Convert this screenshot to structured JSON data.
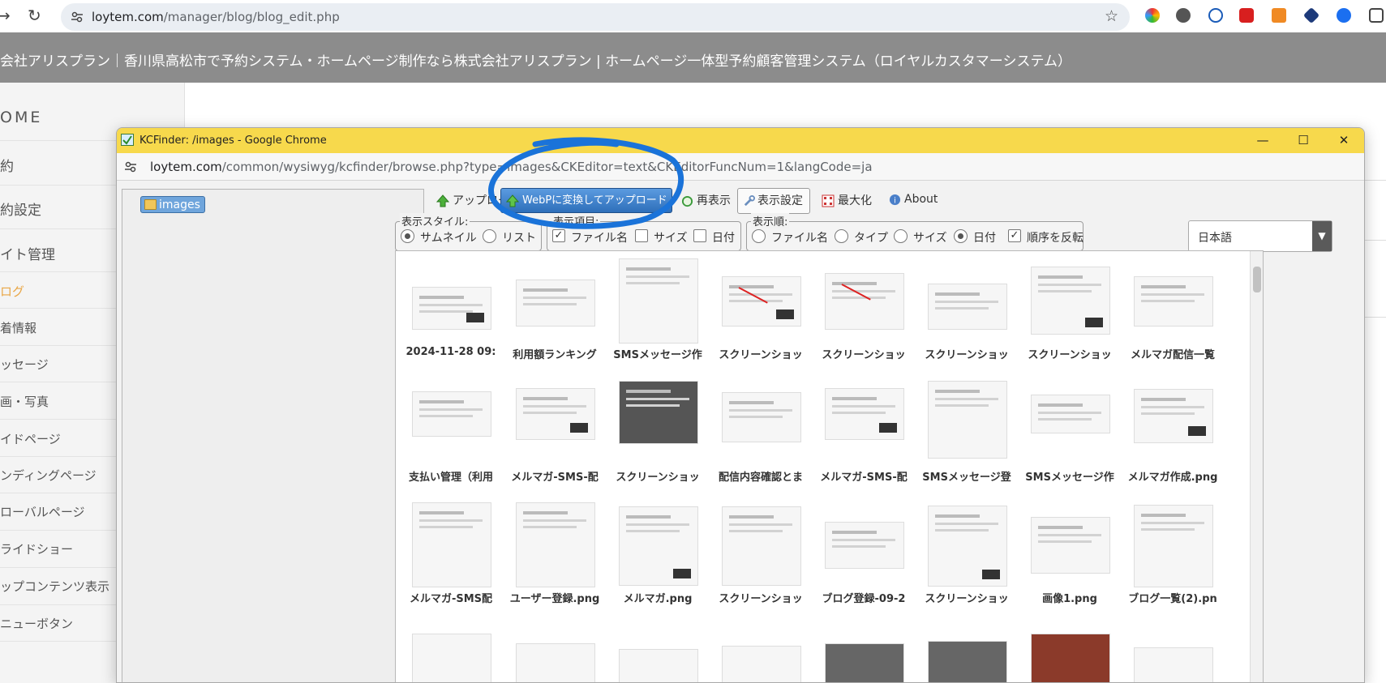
{
  "browser": {
    "url_domain": "loytem.com",
    "url_path": "/manager/blog/blog_edit.php",
    "back_glyph": "→",
    "reload_glyph": "↻",
    "star_glyph": "☆"
  },
  "site": {
    "header_title": "会社アリスプラン｜香川県高松市で予約システム・ホームページ制作なら株式会社アリスプラン | ホームページ一体型予約顧客管理システム（ロイヤルカスタマーシステム）"
  },
  "sidebar": {
    "items": [
      {
        "label": "OME",
        "active": false
      },
      {
        "label": "約",
        "active": false
      },
      {
        "label": "約設定",
        "active": false
      },
      {
        "label": "イト管理",
        "active": false
      },
      {
        "label": "ログ",
        "active": true
      },
      {
        "label": "着情報",
        "active": false
      },
      {
        "label": "ッセージ",
        "active": false
      },
      {
        "label": "画・写真",
        "active": false
      },
      {
        "label": "イドページ",
        "active": false
      },
      {
        "label": "ンディングページ",
        "active": false
      },
      {
        "label": "ローバルページ",
        "active": false
      },
      {
        "label": "ライドショー",
        "active": false
      },
      {
        "label": "ップコンテンツ表示",
        "active": false
      },
      {
        "label": "ニューボタン",
        "active": false
      }
    ]
  },
  "popup": {
    "title": "KCFinder: /images - Google Chrome",
    "url_domain": "loytem.com",
    "url_path": "/common/wysiwyg/kcfinder/browse.php?type=images&CKEditor=text&CKEditorFuncNum=1&langCode=ja",
    "minimize_glyph": "—",
    "maximize_glyph": "☐",
    "close_glyph": "✕"
  },
  "tree": {
    "folder": "images"
  },
  "toolbar": {
    "upload": "アップロード",
    "webp_upload": "WebPに変換してアップロード",
    "refresh": "再表示",
    "settings": "表示設定",
    "maximize": "最大化",
    "about": "About"
  },
  "settings": {
    "view_style": {
      "legend": "表示スタイル:",
      "thumbnail": "サムネイル",
      "list": "リスト",
      "selected": "thumbnail"
    },
    "show_items": {
      "legend": "表示項目:",
      "filename": "ファイル名",
      "size": "サイズ",
      "date": "日付",
      "filename_checked": true,
      "size_checked": false,
      "date_checked": false
    },
    "order": {
      "legend": "表示順:",
      "filename": "ファイル名",
      "type": "タイプ",
      "size": "サイズ",
      "date": "日付",
      "reverse": "順序を反転",
      "selected": "date",
      "reverse_checked": true
    },
    "language": "日本語"
  },
  "files": [
    "2024-11-28 09:",
    "利用額ランキング",
    "SMSメッセージ作",
    "スクリーンショッ",
    "スクリーンショッ",
    "スクリーンショッ",
    "スクリーンショッ",
    "メルマガ配信一覧",
    "支払い管理（利用",
    "メルマガ-SMS-配",
    "スクリーンショッ",
    "配信内容確認とま",
    "メルマガ-SMS-配",
    "SMSメッセージ登",
    "SMSメッセージ作",
    "メルマガ作成.png",
    "メルマガ-SMS配",
    "ユーザー登録.png",
    "メルマガ.png",
    "スクリーンショッ",
    "ブログ登録-09-2",
    "スクリーンショッ",
    "画像1.png",
    "ブログ一覧(2).pn"
  ],
  "colors": {
    "popup_titlebar": "#f7d94c",
    "header_band": "#8c8c8c",
    "accent_blue": "#2e6fba",
    "annotation_blue": "#1a73d9",
    "active_menu": "#e9a645"
  }
}
